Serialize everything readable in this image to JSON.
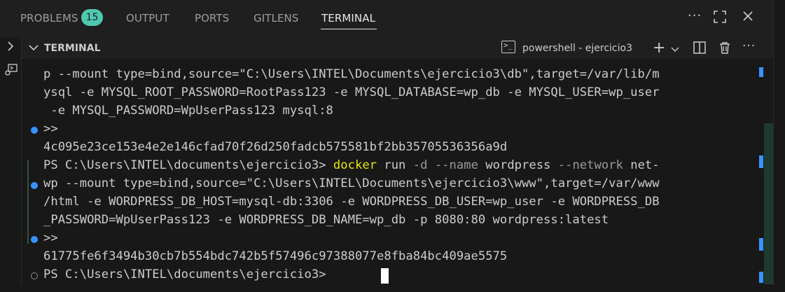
{
  "panel_tabs": [
    {
      "label": "PROBLEMS",
      "badge": "15"
    },
    {
      "label": "OUTPUT"
    },
    {
      "label": "PORTS"
    },
    {
      "label": "GITLENS"
    },
    {
      "label": "TERMINAL",
      "active": true
    }
  ],
  "icons": {
    "more": "more-actions-icon",
    "maximize": "maximize-panel-icon",
    "close": "close-panel-icon",
    "new_terminal": "plus-icon",
    "split": "split-terminal-icon",
    "kill": "trash-icon"
  },
  "section": {
    "title": "TERMINAL",
    "terminal_name": "powershell - ejercicio3"
  },
  "terminal_lines": [
    "p --mount type=bind,source=\"C:\\Users\\INTEL\\Documents\\ejercicio3\\db\",target=/var/lib/m",
    "ysql -e MYSQL_ROOT_PASSWORD=RootPass123 -e MYSQL_DATABASE=wp_db -e MYSQL_USER=wp_user",
    " -e MYSQL_PASSWORD=WpUserPass123 mysql:8",
    ">>",
    "4c095e23ce153e4e2e146cfad70f26d250fadcb575581bf2bb35705536356a9d",
    "",
    "wp --mount type=bind,source=\"C:\\Users\\INTEL\\Documents\\ejercicio3\\www\",target=/var/www",
    "/html -e WORDPRESS_DB_HOST=mysql-db:3306 -e WORDPRESS_DB_USER=wp_user -e WORDPRESS_DB",
    "_PASSWORD=WpUserPass123 -e WORDPRESS_DB_NAME=wp_db -p 8080:80 wordpress:latest",
    ">>",
    "61775fe6f3494b30cb7b554bdc742b5f57496c97388077e8fba84bc409ae5575",
    "PS C:\\Users\\INTEL\\documents\\ejercicio3> "
  ],
  "command_line": {
    "prompt": "PS C:\\Users\\INTEL\\documents\\ejercicio3> ",
    "command": "docker",
    "rest_1": " run ",
    "flag_1": "-d",
    "rest_2": " ",
    "flag_2": "--name",
    "rest_3": " wordpress ",
    "flag_3": "--network",
    "rest_4": " net-"
  },
  "colors": {
    "accent_blue": "#3794ff",
    "command_yellow": "#e5e510",
    "badge_teal": "#4ec9b0"
  }
}
